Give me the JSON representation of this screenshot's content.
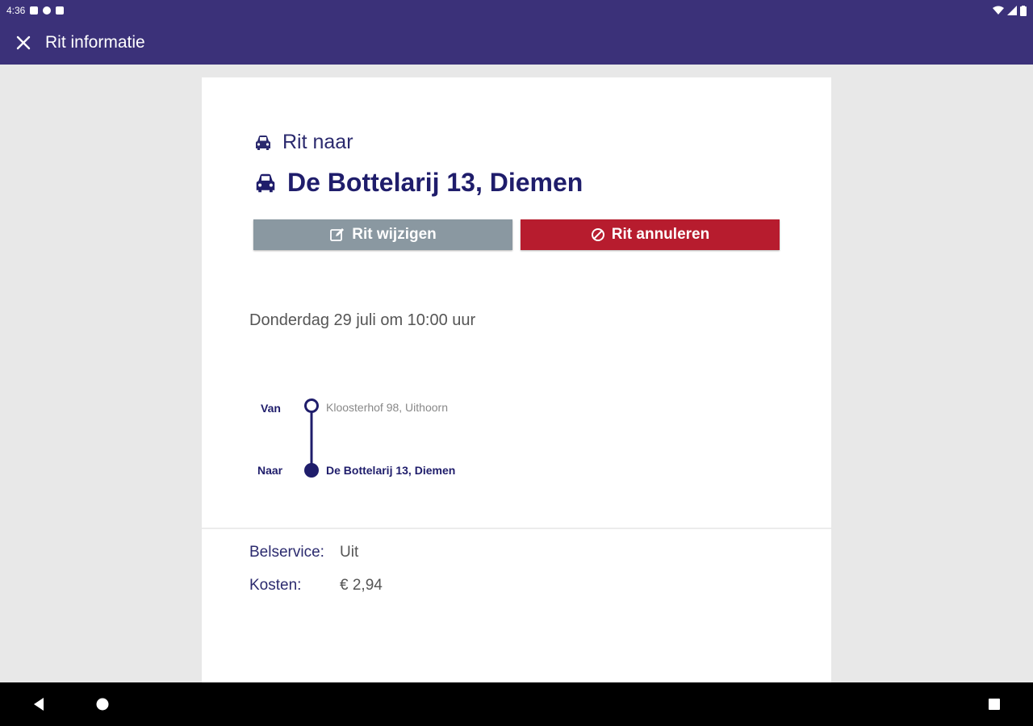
{
  "status_bar": {
    "time": "4:36"
  },
  "app_bar": {
    "title": "Rit informatie"
  },
  "trip": {
    "label": "Rit naar",
    "destination": "De Bottelarij 13, Diemen",
    "edit_label": "Rit wijzigen",
    "cancel_label": "Rit annuleren",
    "datetime": "Donderdag 29 juli om 10:00 uur"
  },
  "route": {
    "from_label": "Van",
    "from_address": "Kloosterhof 98, Uithoorn",
    "to_label": "Naar",
    "to_address": "De Bottelarij 13, Diemen"
  },
  "details": {
    "belservice_label": "Belservice:",
    "belservice_value": "Uit",
    "kosten_label": "Kosten:",
    "kosten_value": "€ 2,94"
  },
  "colors": {
    "primary": "#3b3179",
    "dark_blue": "#1f1d6b",
    "edit_button": "#8a98a1",
    "cancel_button": "#b71c2e"
  },
  "icons": {
    "close": "close-icon",
    "car": "car-icon",
    "edit": "edit-icon",
    "cancel": "cancel-icon"
  }
}
